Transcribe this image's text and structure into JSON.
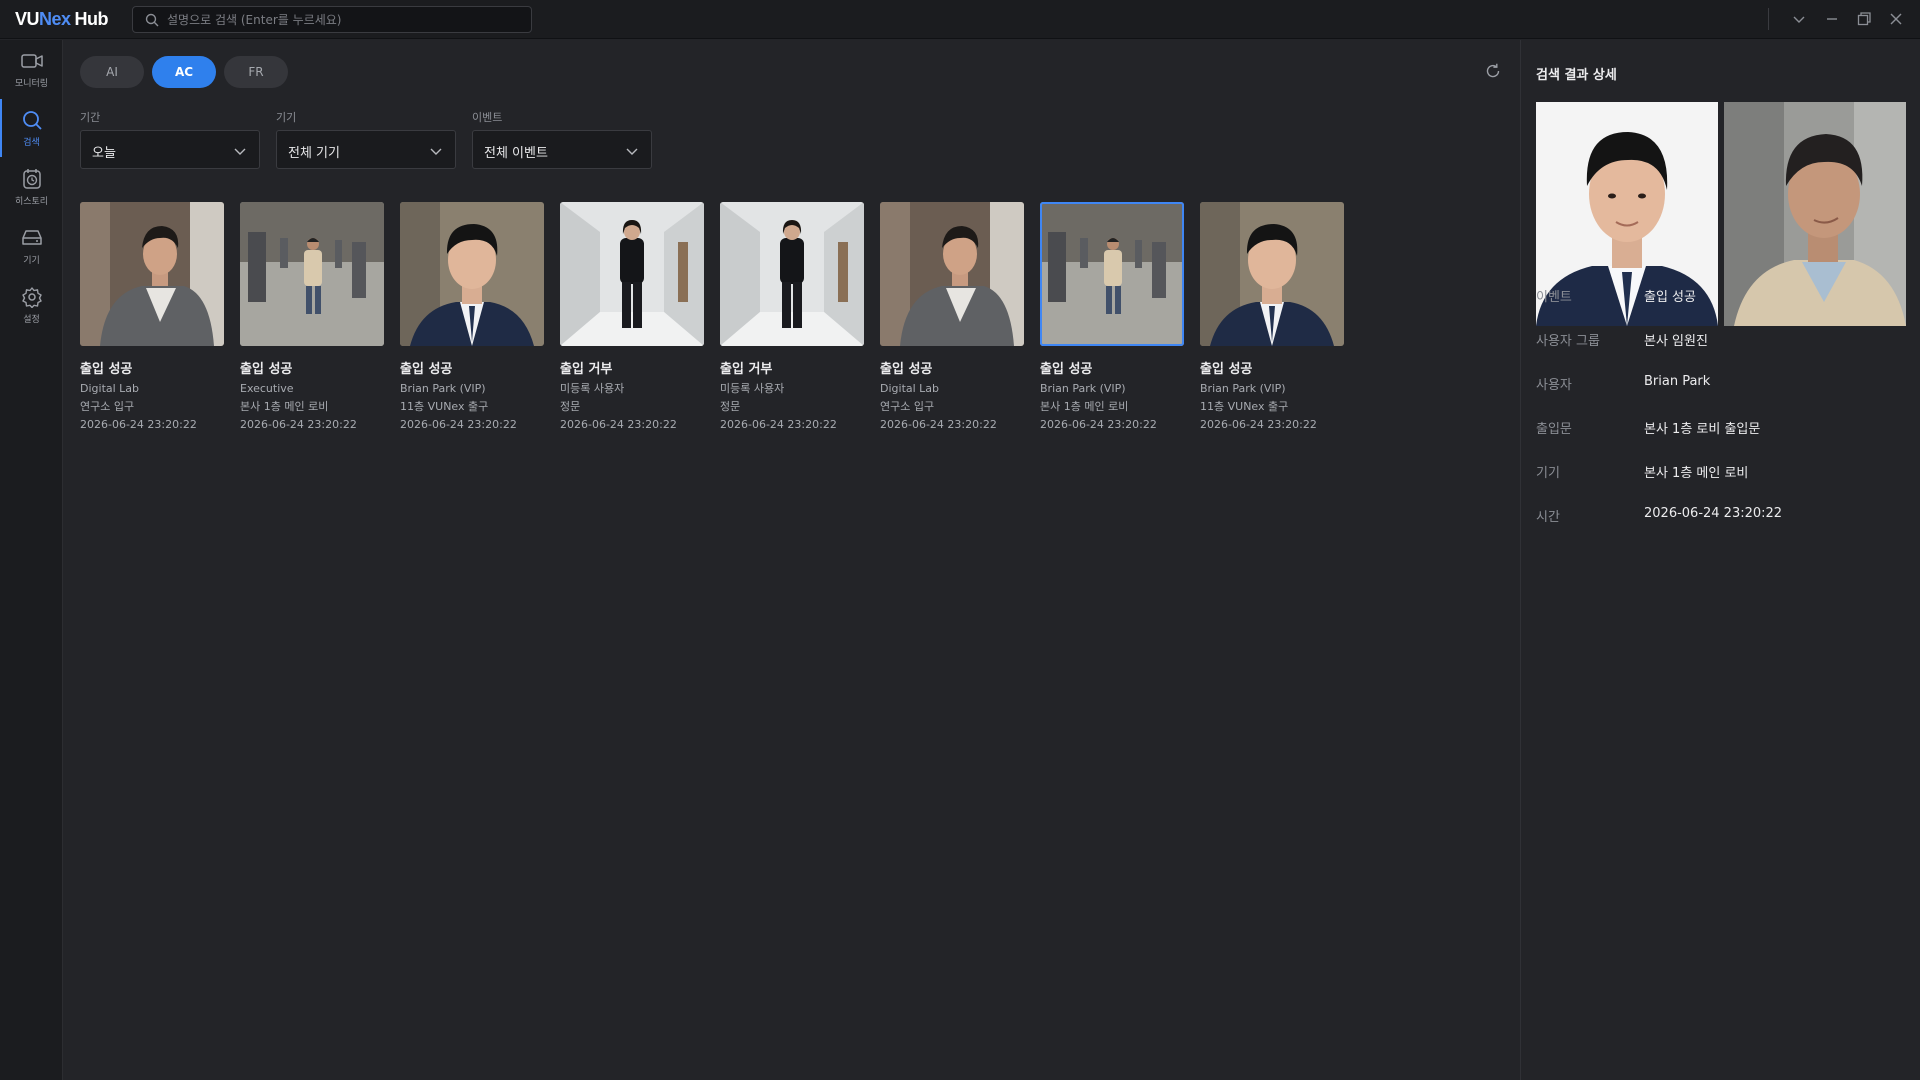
{
  "app": {
    "logo_vu": "VU",
    "logo_nex": "Nex",
    "logo_hub": "Hub"
  },
  "search": {
    "placeholder": "설명으로 검색 (Enter를 누르세요)"
  },
  "window_controls": [
    "chevron-down-icon",
    "minimize-icon",
    "restore-icon",
    "close-icon"
  ],
  "nav": [
    {
      "label": "모니터링",
      "icon": "video-camera-icon"
    },
    {
      "label": "검색",
      "icon": "search-icon",
      "active": true
    },
    {
      "label": "히스토리",
      "icon": "history-icon"
    },
    {
      "label": "기기",
      "icon": "device-icon"
    },
    {
      "label": "설정",
      "icon": "gear-icon"
    }
  ],
  "tabs": [
    {
      "label": "AI",
      "active": false
    },
    {
      "label": "AC",
      "active": true
    },
    {
      "label": "FR",
      "active": false
    }
  ],
  "filters": {
    "period": {
      "label": "기간",
      "value": "오늘"
    },
    "device": {
      "label": "기기",
      "value": "전체 기기"
    },
    "event": {
      "label": "이벤트",
      "value": "전체 이벤트"
    }
  },
  "results": [
    {
      "title": "출입 성공",
      "line1": "Digital Lab",
      "line2": "연구소 입구",
      "time": "2026-06-24 23:20:22"
    },
    {
      "title": "출입 성공",
      "line1": "Executive",
      "line2": "본사 1층 메인 로비",
      "time": "2026-06-24 23:20:22"
    },
    {
      "title": "출입 성공",
      "line1": "Brian Park (VIP)",
      "line2": "11층 VUNex 출구",
      "time": "2026-06-24 23:20:22"
    },
    {
      "title": "출입 거부",
      "line1": "미등록 사용자",
      "line2": "정문",
      "time": "2026-06-24 23:20:22"
    },
    {
      "title": "출입 거부",
      "line1": "미등록 사용자",
      "line2": "정문",
      "time": "2026-06-24 23:20:22"
    },
    {
      "title": "출입 성공",
      "line1": "Digital Lab",
      "line2": "연구소 입구",
      "time": "2026-06-24 23:20:22"
    },
    {
      "title": "출입 성공",
      "line1": "Brian Park (VIP)",
      "line2": "본사 1층 메인 로비",
      "time": "2026-06-24 23:20:22",
      "selected": true
    },
    {
      "title": "출입 성공",
      "line1": "Brian Park (VIP)",
      "line2": "11층 VUNex 출구",
      "time": "2026-06-24 23:20:22"
    }
  ],
  "detail": {
    "title": "검색 결과 상세",
    "rows": [
      {
        "key": "이벤트",
        "value": "출입 성공"
      },
      {
        "key": "사용자 그룹",
        "value": "본사 임원진"
      },
      {
        "key": "사용자",
        "value": "Brian Park"
      },
      {
        "key": "출입문",
        "value": "본사 1층 로비 출입문"
      },
      {
        "key": "기기",
        "value": "본사 1층 메인 로비"
      },
      {
        "key": "시간",
        "value": "2026-06-24 23:20:22"
      }
    ]
  },
  "colors": {
    "accent": "#2f80ed",
    "background": "#232428",
    "sidebar": "#1b1c1f"
  }
}
